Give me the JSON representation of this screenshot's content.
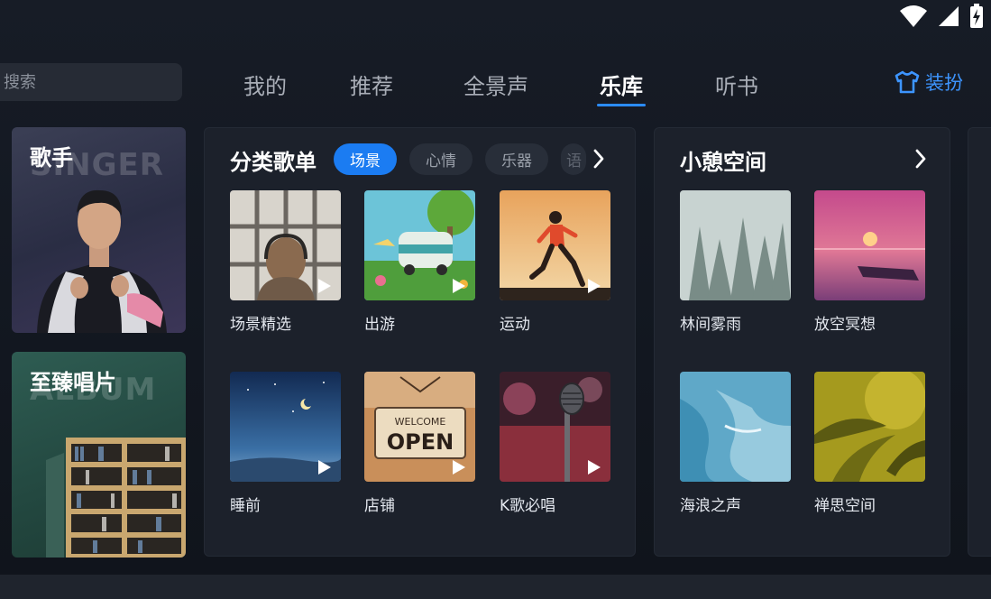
{
  "status_bar": {
    "icons": [
      "wifi-icon",
      "cellular-signal-icon",
      "battery-charging-icon"
    ]
  },
  "search": {
    "placeholder": "搜索"
  },
  "tabs": [
    {
      "label": "我的",
      "active": false
    },
    {
      "label": "推荐",
      "active": false
    },
    {
      "label": "全景声",
      "active": false
    },
    {
      "label": "乐库",
      "active": true
    },
    {
      "label": "听书",
      "active": false
    }
  ],
  "dressup": {
    "label": "装扮",
    "icon": "tshirt-icon"
  },
  "side_cards": {
    "singer": {
      "title": "歌手",
      "watermark": "SINGER"
    },
    "album": {
      "title": "至臻唱片",
      "watermark": "ALBUM"
    }
  },
  "category_panel": {
    "title": "分类歌单",
    "chips": [
      {
        "label": "场景",
        "active": true
      },
      {
        "label": "心情",
        "active": false
      },
      {
        "label": "乐器",
        "active": false
      },
      {
        "label": "语",
        "active": false
      }
    ],
    "items": [
      {
        "label": "场景精选"
      },
      {
        "label": "出游"
      },
      {
        "label": "运动"
      },
      {
        "label": "睡前"
      },
      {
        "label": "店铺"
      },
      {
        "label": "K歌必唱"
      }
    ]
  },
  "relax_panel": {
    "title": "小憩空间",
    "items": [
      {
        "label": "林间雾雨"
      },
      {
        "label": "放空冥想"
      },
      {
        "label": "海浪之声"
      },
      {
        "label": "禅思空间"
      }
    ]
  },
  "colors": {
    "accent": "#1b7cf2",
    "tab_underline": "#2b8cff",
    "dressup": "#3d95ff"
  },
  "cover_text": {
    "welcome": "WELCOME",
    "open": "OPEN"
  }
}
